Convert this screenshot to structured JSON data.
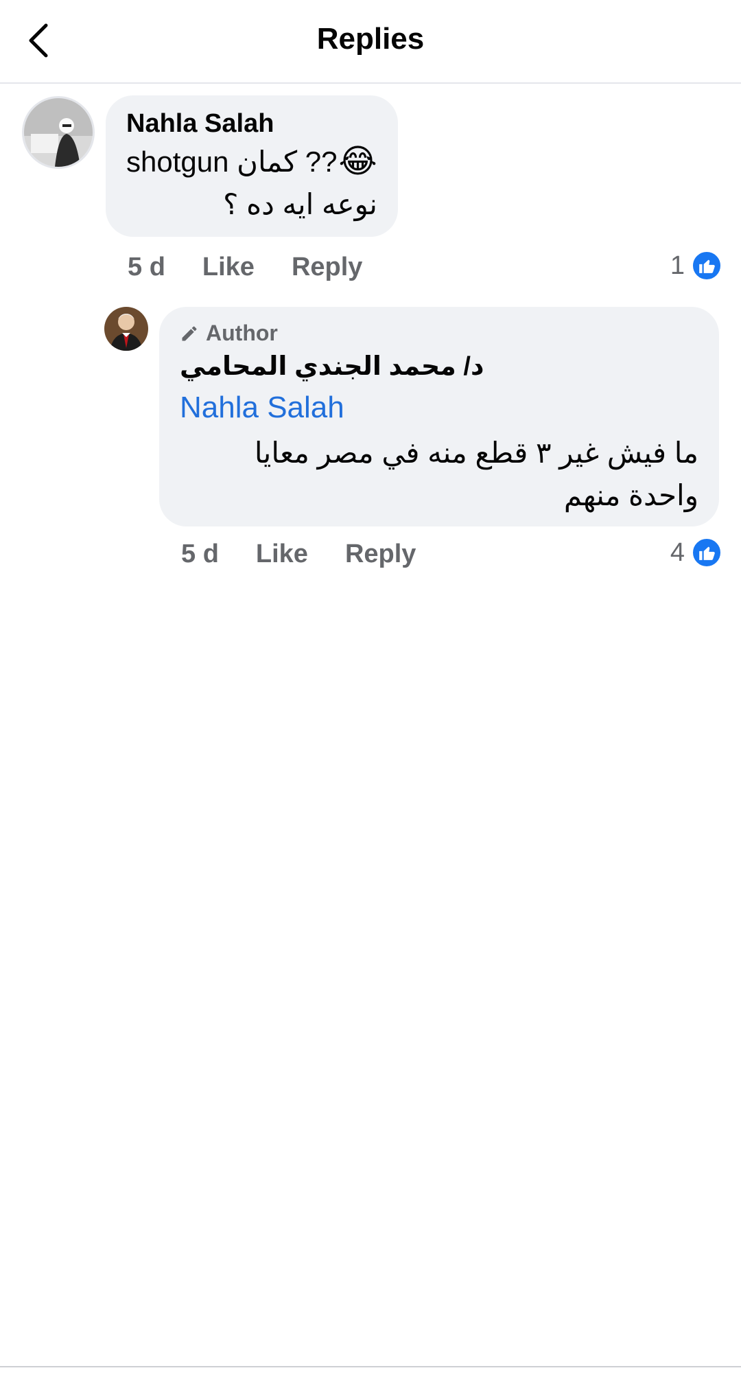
{
  "header": {
    "title": "Replies"
  },
  "comment": {
    "author": "Nahla Salah",
    "line1_text": "shotgun كمان ??",
    "line2_text": "نوعه ايه ده ؟",
    "emoji": "😂",
    "time": "5 d",
    "like_label": "Like",
    "reply_label": "Reply",
    "reaction_count": "1"
  },
  "reply": {
    "badge": "Author",
    "author": "د/ محمد الجندي المحامي",
    "mention": "Nahla Salah",
    "text": "ما فيش غير ٣ قطع منه في مصر معايا واحدة منهم",
    "time": "5 d",
    "like_label": "Like",
    "reply_label": "Reply",
    "reaction_count": "4"
  },
  "colors": {
    "like_blue": "#1877f2",
    "mention_blue": "#216fdb",
    "bubble_bg": "#f0f2f5",
    "muted_text": "#65676b"
  }
}
